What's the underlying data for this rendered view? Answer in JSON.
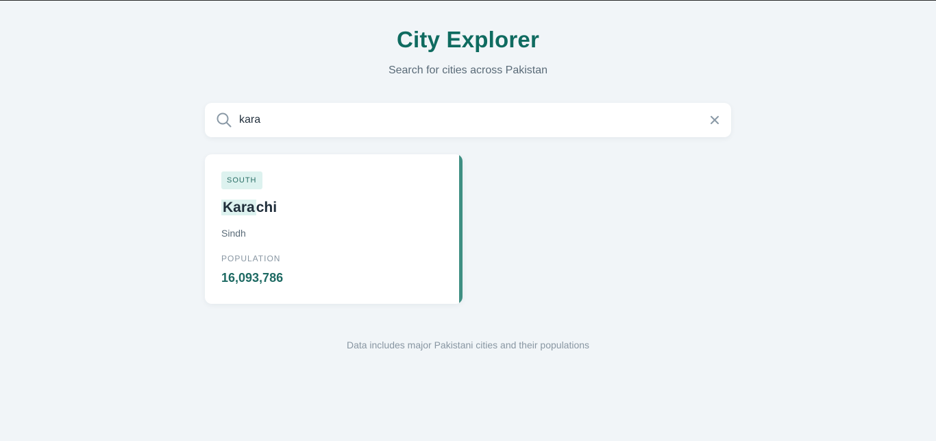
{
  "header": {
    "title": "City Explorer",
    "subtitle": "Search for cities across Pakistan"
  },
  "search": {
    "value": "kara",
    "search_icon": "search-icon",
    "clear_icon": "close-icon"
  },
  "results": [
    {
      "region": "SOUTH",
      "name_match": "Kara",
      "name_rest": "chi",
      "province": "Sindh",
      "population_label": "POPULATION",
      "population": "16,093,786"
    }
  ],
  "footer": {
    "note": "Data includes major Pakistani cities and their populations"
  },
  "colors": {
    "accent": "#0f6b60",
    "card_stripe": "#3f8f83",
    "highlight": "#ddf2ef",
    "background": "#f1f5f8"
  }
}
